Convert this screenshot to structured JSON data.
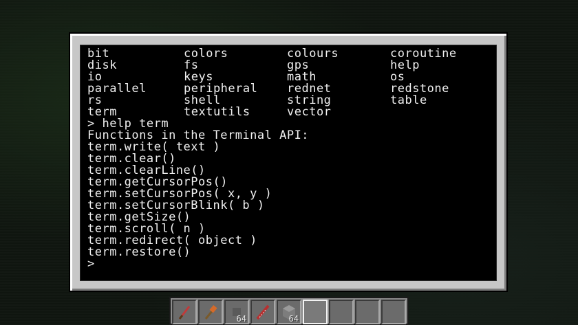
{
  "api_list": [
    [
      "bit",
      "colors",
      "colours",
      "coroutine"
    ],
    [
      "disk",
      "fs",
      "gps",
      "help"
    ],
    [
      "io",
      "keys",
      "math",
      "os"
    ],
    [
      "parallel",
      "peripheral",
      "rednet",
      "redstone"
    ],
    [
      "rs",
      "shell",
      "string",
      "table"
    ],
    [
      "term",
      "textutils",
      "vector",
      ""
    ]
  ],
  "output_lines": [
    "> help term",
    "Functions in the Terminal API:",
    "term.write( text )",
    "term.clear()",
    "term.clearLine()",
    "term.getCursorPos()",
    "term.setCursorPos( x, y )",
    "term.setCursorBlink( b )",
    "term.getSize()",
    "term.scroll( n )",
    "term.redirect( object )",
    "term.restore()"
  ],
  "prompt": ">",
  "hotbar": {
    "slots": [
      {
        "icon": "red-wand-icon",
        "count": ""
      },
      {
        "icon": "brush-icon",
        "count": ""
      },
      {
        "icon": "",
        "count": "64"
      },
      {
        "icon": "red-striped-item-icon",
        "count": ""
      },
      {
        "icon": "stone-block-icon",
        "count": "64"
      },
      {
        "icon": "",
        "count": ""
      },
      {
        "icon": "",
        "count": ""
      },
      {
        "icon": "",
        "count": ""
      },
      {
        "icon": "",
        "count": ""
      }
    ],
    "selected_index": 5
  }
}
